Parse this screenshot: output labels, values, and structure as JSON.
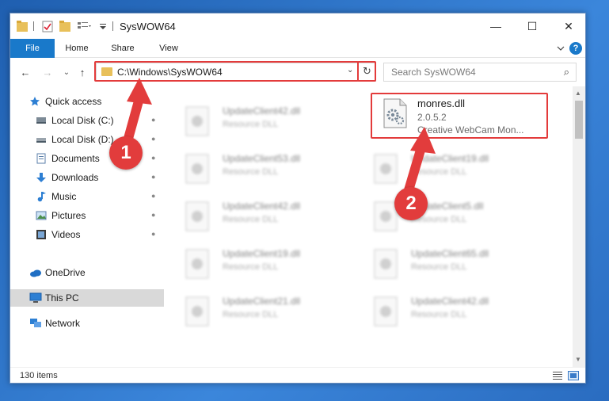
{
  "window": {
    "title": "SysWOW64",
    "minimize_glyph": "—",
    "maximize_glyph": "☐",
    "close_glyph": "✕"
  },
  "ribbon": {
    "tabs": [
      "File",
      "Home",
      "Share",
      "View"
    ],
    "help_glyph": "?"
  },
  "nav": {
    "back_glyph": "←",
    "forward_glyph": "→",
    "recent_glyph": "⌄",
    "up_glyph": "↑"
  },
  "address": {
    "path": "C:\\Windows\\SysWOW64",
    "dropdown_glyph": "⌄",
    "refresh_glyph": "↻"
  },
  "search": {
    "placeholder": "Search SysWOW64",
    "icon_glyph": "⌕"
  },
  "sidebar": {
    "quick_access": "Quick access",
    "items": [
      {
        "label": "Local Disk (C:)",
        "icon": "drive-icon"
      },
      {
        "label": "Local Disk (D:)",
        "icon": "drive-icon"
      },
      {
        "label": "Documents",
        "icon": "documents-icon"
      },
      {
        "label": "Downloads",
        "icon": "downloads-icon"
      },
      {
        "label": "Music",
        "icon": "music-icon"
      },
      {
        "label": "Pictures",
        "icon": "pictures-icon"
      },
      {
        "label": "Videos",
        "icon": "videos-icon"
      }
    ],
    "pin_glyph": "📌",
    "onedrive": "OneDrive",
    "this_pc": "This PC",
    "network": "Network"
  },
  "files": {
    "left_column": [
      {
        "name": "UpdateClient42.dll",
        "type": "Resource DLL"
      },
      {
        "name": "UpdateClient53.dll",
        "type": "Resource DLL"
      },
      {
        "name": "UpdateClient42.dll",
        "type": "Resource DLL"
      },
      {
        "name": "UpdateClient19.dll",
        "type": "Resource DLL"
      },
      {
        "name": "UpdateClient21.dll",
        "type": "Resource DLL"
      }
    ],
    "right_column": [
      {
        "name": "UpdateClient19.dll",
        "type": "Resource DLL"
      },
      {
        "name": "UpdateClient5.dll",
        "type": "Resource DLL"
      },
      {
        "name": "UpdateClient65.dll",
        "type": "Resource DLL"
      },
      {
        "name": "UpdateClient42.dll",
        "type": "Resource DLL"
      }
    ],
    "highlighted": {
      "name": "monres.dll",
      "version": "2.0.5.2",
      "description": "Creative WebCam Mon..."
    }
  },
  "status": {
    "count": "130 items"
  },
  "annotations": {
    "marker_1": "1",
    "marker_2": "2",
    "accent_color": "#e23c3c"
  }
}
